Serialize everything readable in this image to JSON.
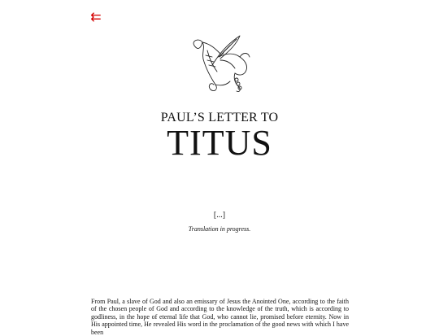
{
  "nav": {
    "back_glyph": "⇇",
    "back_icon": "double-left-arrow-icon",
    "accent_color": "#d40000"
  },
  "header": {
    "emblem_icon": "quill-scroll-emblem-icon",
    "subtitle": "PAUL’S LETTER TO",
    "title": "TITUS"
  },
  "status": {
    "ellipsis": "[...]",
    "note": "Translation in progress."
  },
  "content": {
    "paragraph": "From Paul, a slave of God and also an emissary of Jesus the Anointed One, according to the faith of the chosen people of God and according to the knowledge of the truth, which is according to godliness, in the hope of eternal life that God, who cannot lie, promised before eternity. Now in His appointed time, He revealed His word in the proclamation of the good news with which I have been"
  }
}
